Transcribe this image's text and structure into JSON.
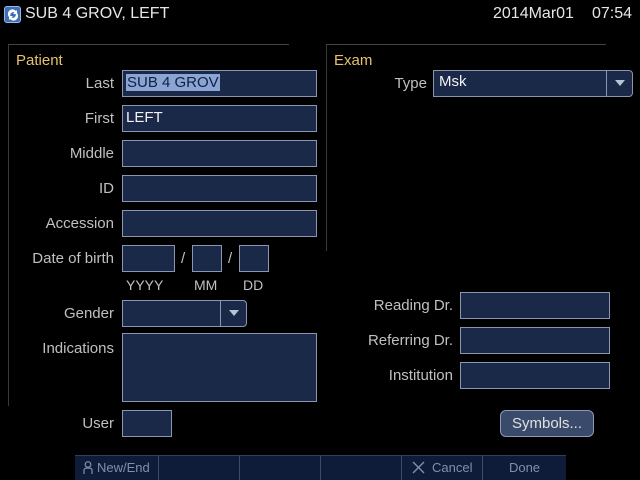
{
  "titlebar": {
    "patient_name": "SUB 4 GROV, LEFT",
    "date": "2014Mar01",
    "time": "07:54"
  },
  "patient": {
    "section_title": "Patient",
    "last_label": "Last",
    "last_value": "SUB 4 GROV",
    "first_label": "First",
    "first_value": "LEFT",
    "middle_label": "Middle",
    "middle_value": "",
    "id_label": "ID",
    "id_value": "",
    "accession_label": "Accession",
    "accession_value": "",
    "dob_label": "Date of birth",
    "dob_year": "",
    "dob_month": "",
    "dob_day": "",
    "dob_separator": "/",
    "dob_year_hint": "YYYY",
    "dob_month_hint": "MM",
    "dob_day_hint": "DD",
    "gender_label": "Gender",
    "gender_value": "",
    "indications_label": "Indications",
    "indications_value": "",
    "user_label": "User",
    "user_value": ""
  },
  "exam": {
    "section_title": "Exam",
    "type_label": "Type",
    "type_value": "Msk",
    "reading_label": "Reading Dr.",
    "reading_value": "",
    "referring_label": "Referring Dr.",
    "referring_value": "",
    "institution_label": "Institution",
    "institution_value": "",
    "symbols_label": "Symbols..."
  },
  "bottombar": {
    "new_end_label": "New/End",
    "cancel_label": "Cancel",
    "done_label": "Done"
  },
  "icons": {
    "app": "app-logo-icon",
    "person": "person-icon",
    "cancel": "close-icon",
    "dropdown": "chevron-down-icon"
  },
  "colors": {
    "section_title": "#e6c26e",
    "field_background": "#1b2948",
    "bottombar_background": "#0e1c3a"
  }
}
